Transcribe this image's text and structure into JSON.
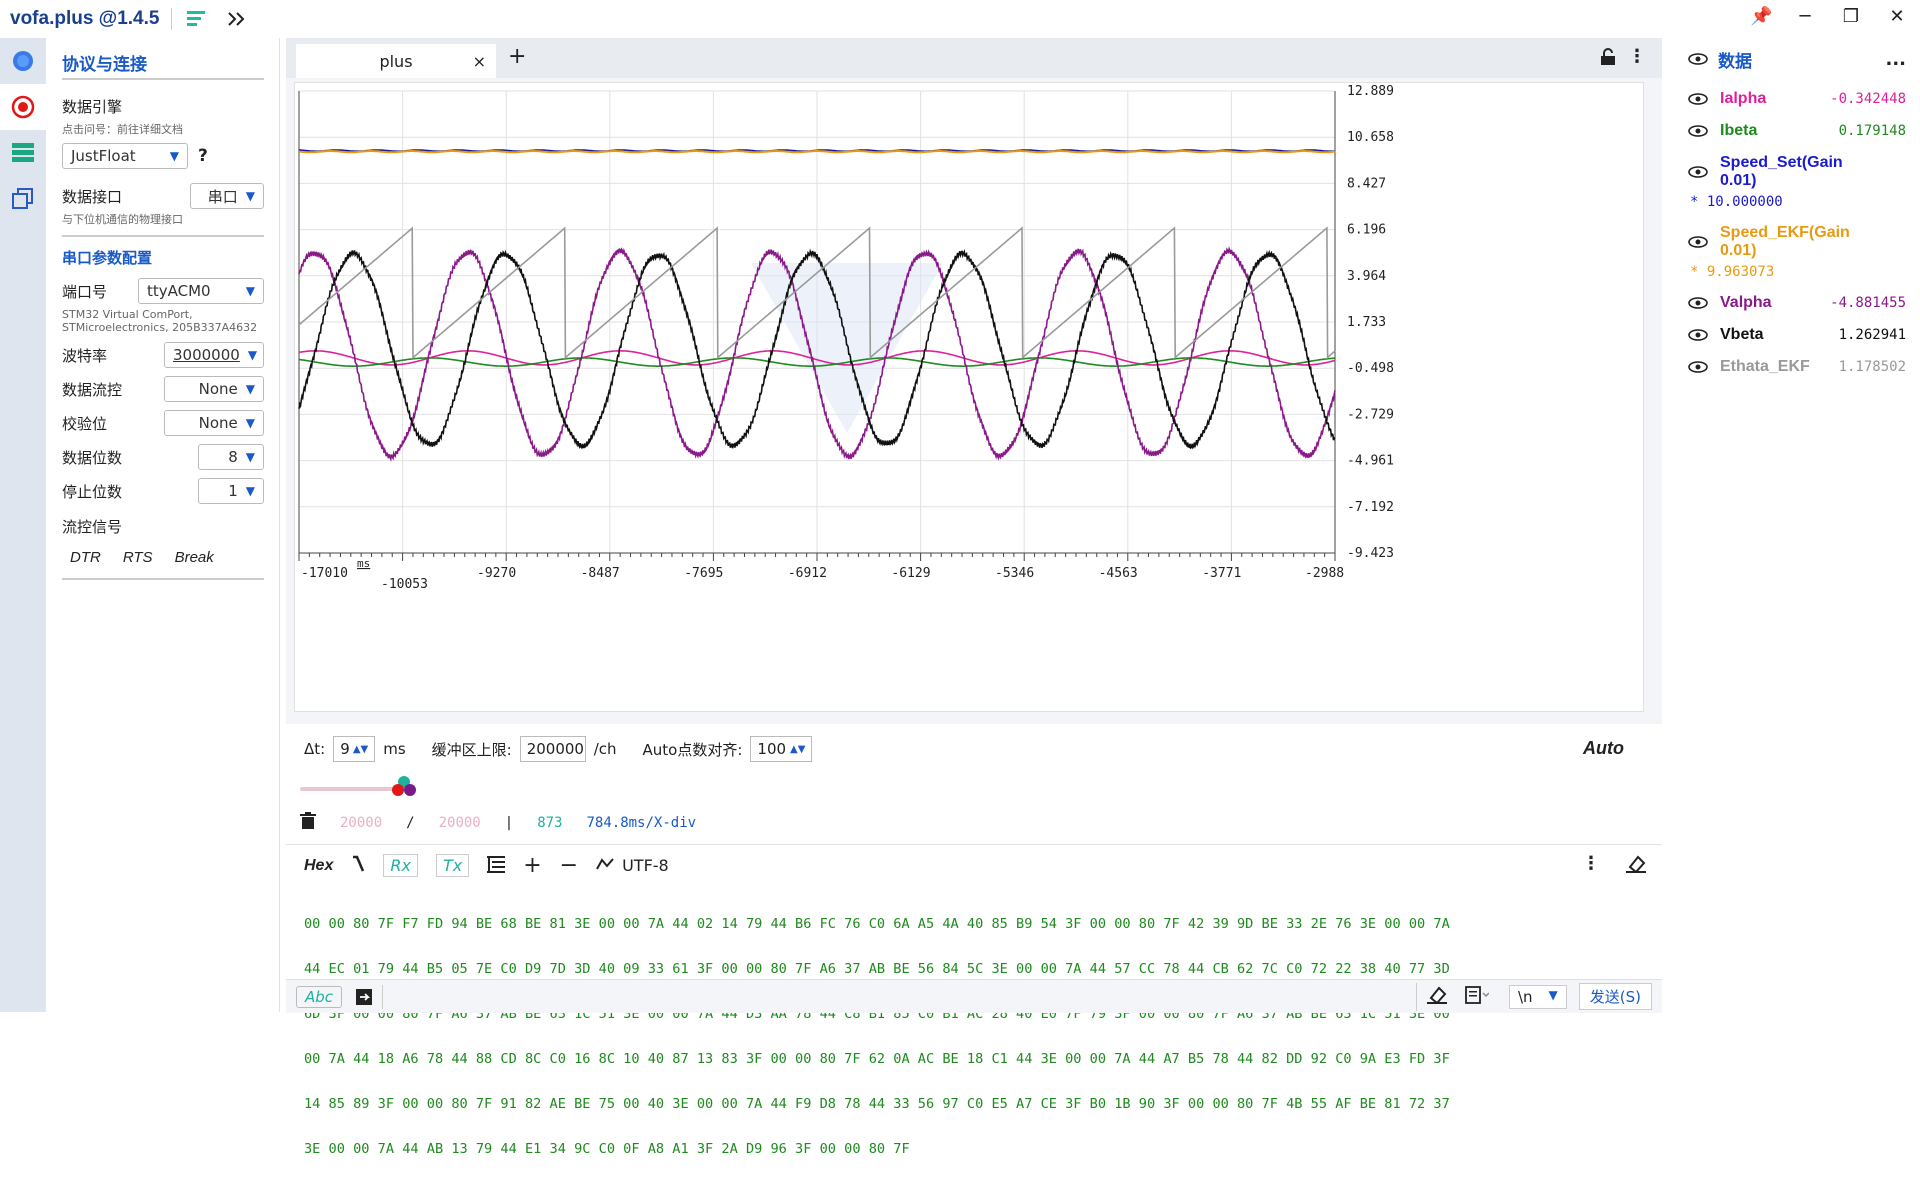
{
  "app": {
    "title": "vofa.plus @1.4.5"
  },
  "left": {
    "section1_title": "协议与连接",
    "engine_label": "数据引擎",
    "engine_hint": "点击问号：前往详细文档",
    "engine_value": "JustFloat",
    "help": "?",
    "iface_label": "数据接口",
    "iface_value": "串口",
    "iface_hint": "与下位机通信的物理接口",
    "section2_title": "串口参数配置",
    "port_label": "端口号",
    "port_value": "ttyACM0",
    "port_desc1": "STM32 Virtual ComPort,",
    "port_desc2": "STMicroelectronics, 205B337A4632",
    "baud_label": "波特率",
    "baud_value": "3000000",
    "flow_label": "数据流控",
    "flow_value": "None",
    "parity_label": "校验位",
    "parity_value": "None",
    "bits_label": "数据位数",
    "bits_value": "8",
    "stop_label": "停止位数",
    "stop_value": "1",
    "signal_label": "流控信号",
    "dtr": "DTR",
    "rts": "RTS",
    "brk": "Break"
  },
  "tab": {
    "label": "plus",
    "close": "×",
    "add": "+"
  },
  "chart_data": {
    "type": "line",
    "y_ticks": [
      "12.889",
      "10.658",
      "8.427",
      "6.196",
      "3.964",
      "1.733",
      "-0.498",
      "-2.729",
      "-4.961",
      "-7.192",
      "-9.423"
    ],
    "ylim": [
      -9.423,
      12.889
    ],
    "x_ticks": [
      "-17010",
      "-10053",
      "-9270",
      "-8487",
      "-7695",
      "-6912",
      "-6129",
      "-5346",
      "-4563",
      "-3771",
      "-2988"
    ],
    "xunit": "ms",
    "series": [
      {
        "name": "Ialpha",
        "color": "#e0209a",
        "kind": "sine",
        "amp": 0.34,
        "offset": 0.0,
        "period": 1180,
        "phase": 0.0
      },
      {
        "name": "Ibeta",
        "color": "#1f8a1f",
        "kind": "sine",
        "amp": 0.2,
        "offset": -0.2,
        "period": 1180,
        "phase": 1.57
      },
      {
        "name": "Speed_Set(Gain 0.01)",
        "color": "#1a1aa0",
        "kind": "const",
        "value": 10.0
      },
      {
        "name": "Speed_EKF(Gain 0.01)",
        "color": "#e89a10",
        "kind": "const",
        "value": 9.96
      },
      {
        "name": "Valpha",
        "color": "#8a1a8a",
        "kind": "sine",
        "amp": 4.9,
        "offset": 0.2,
        "period": 1180,
        "phase": 0.0
      },
      {
        "name": "Vbeta",
        "color": "#111111",
        "kind": "sine",
        "amp": 4.6,
        "offset": 0.4,
        "period": 1180,
        "phase": -1.57
      },
      {
        "name": "Ethata_EKF",
        "color": "#9a9a9a",
        "kind": "saw",
        "min": 0.0,
        "max": 6.28,
        "period": 1180
      }
    ]
  },
  "controls": {
    "dt_label": "Δt:",
    "dt_value": "9",
    "dt_unit": "ms",
    "buf_label": "缓冲区上限:",
    "buf_value": "200000",
    "buf_unit": "/ch",
    "auto_label": "Auto点数对齐:",
    "auto_value": "100",
    "auto_btn": "Auto",
    "stat1": "20000",
    "slash": "/",
    "stat2": "20000",
    "bar": "|",
    "stat3": "873",
    "xdiv": "784.8ms/X-div"
  },
  "hex": {
    "hex_btn": "Hex",
    "rx": "Rx",
    "tx": "Tx",
    "encoding": "UTF-8",
    "lines": [
      "00 00 80 7F F7 FD 94 BE 68 BE 81 3E 00 00 7A 44 02 14 79 44 B6 FC 76 C0 6A A5 4A 40 85 B9 54 3F 00 00 80 7F 42 39 9D BE 33 2E 76 3E 00 00 7A",
      "44 EC 01 79 44 B5 05 7E C0 D9 7D 3D 40 09 33 61 3F 00 00 80 7F A6 37 AB BE 56 84 5C 3E 00 00 7A 44 57 CC 78 44 CB 62 7C C0 72 22 38 40 77 3D",
      "6D 3F 00 00 80 7F A6 37 AB BE 63 1C 51 3E 00 00 7A 44 D3 AA 78 44 C8 B1 85 C0 B1 AC 28 40 E0 7F 79 3F 00 00 80 7F A6 37 AB BE 63 1C 51 3E 00",
      "00 7A 44 18 A6 78 44 88 CD 8C C0 16 8C 10 40 87 13 83 3F 00 00 80 7F 62 0A AC BE 18 C1 44 3E 00 00 7A 44 A7 B5 78 44 82 DD 92 C0 9A E3 FD 3F",
      "14 85 89 3F 00 00 80 7F 91 82 AE BE 75 00 40 3E 00 00 7A 44 F9 D8 78 44 33 56 97 C0 E5 A7 CE 3F B0 1B 90 3F 00 00 80 7F 4B 55 AF BE 81 72 37",
      "3E 00 00 7A 44 AB 13 79 44 E1 34 9C C0 0F A8 A1 3F 2A D9 96 3F 00 00 80 7F"
    ],
    "abc": "Abc",
    "newline": "\\n",
    "send": "发送(S)"
  },
  "right": {
    "title": "数据",
    "more": "...",
    "items": [
      {
        "name": "Ialpha",
        "value": "-0.342448",
        "color": "#e0209a"
      },
      {
        "name": "Ibeta",
        "value": "0.179148",
        "color": "#1f8a1f"
      },
      {
        "name": "Speed_Set(Gain 0.01)",
        "value": "* 10.000000",
        "color": "#1a1ad0"
      },
      {
        "name": "Speed_EKF(Gain 0.01)",
        "value": "* 9.963073",
        "color": "#e89a10"
      },
      {
        "name": "Valpha",
        "value": "-4.881455",
        "color": "#8a1a8a"
      },
      {
        "name": "Vbeta",
        "value": "1.262941",
        "color": "#111111"
      },
      {
        "name": "Ethata_EKF",
        "value": "1.178502",
        "color": "#999999"
      }
    ]
  }
}
